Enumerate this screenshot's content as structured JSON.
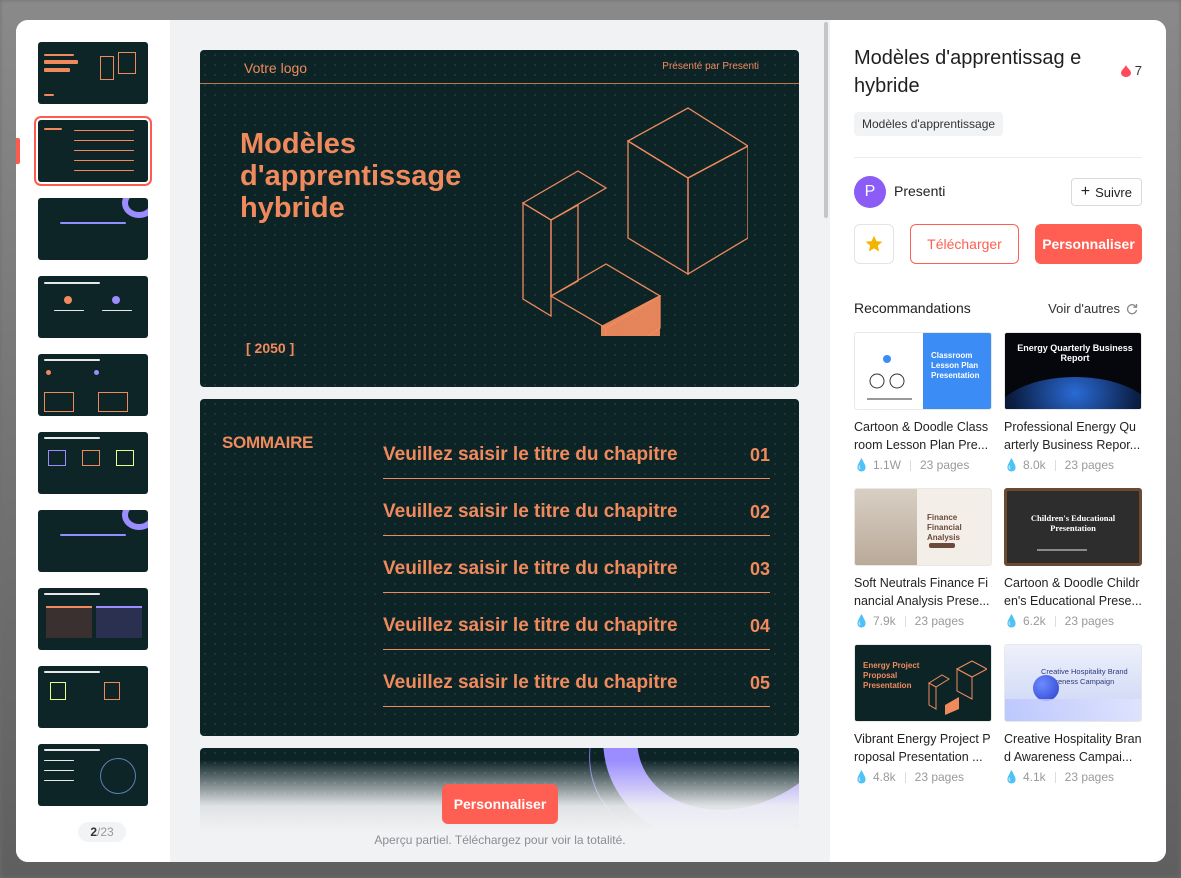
{
  "preview": {
    "slide1": {
      "logo": "Votre logo",
      "presented_by": "Présenté par Presenti",
      "title": "Modèles d'apprentissage hybride",
      "year": "[ 2050 ]"
    },
    "slide2": {
      "heading": "SOMMAIRE",
      "rows": [
        {
          "title": "Veuillez saisir le titre du chapitre",
          "num": "01"
        },
        {
          "title": "Veuillez saisir le titre du chapitre",
          "num": "02"
        },
        {
          "title": "Veuillez saisir le titre du chapitre",
          "num": "03"
        },
        {
          "title": "Veuillez saisir le titre du chapitre",
          "num": "04"
        },
        {
          "title": "Veuillez saisir le titre du chapitre",
          "num": "05"
        }
      ]
    },
    "cta_label": "Personnaliser",
    "partial_note": "Aperçu partiel. Téléchargez pour voir la totalité."
  },
  "thumbnails": {
    "current": "2",
    "total": "/23"
  },
  "info": {
    "title": "Modèles d'apprentissag e hybride",
    "likes": "7",
    "tag": "Modèles d'apprentissage",
    "author_initial": "P",
    "author": "Presenti",
    "follow_label": "Suivre",
    "download_label": "Télécharger",
    "customize_label": "Personnaliser",
    "recommendations_label": "Recommandations",
    "see_more_label": "Voir d'autres"
  },
  "recommendations": [
    {
      "name": "Cartoon & Doodle Classroom Lesson Plan Pre...",
      "views": "1.1W",
      "pages": "23 pages",
      "thumb_text": "Classroom Lesson Plan Presentation"
    },
    {
      "name": "Professional Energy Quarterly Business Repor...",
      "views": "8.0k",
      "pages": "23 pages",
      "thumb_text": "Energy Quarterly Business Report"
    },
    {
      "name": "Soft Neutrals Finance Financial Analysis Prese...",
      "views": "7.9k",
      "pages": "23 pages",
      "thumb_text": "Finance Financial Analysis"
    },
    {
      "name": "Cartoon & Doodle Children's Educational Prese...",
      "views": "6.2k",
      "pages": "23 pages",
      "thumb_text": "Children's Educational Presentation"
    },
    {
      "name": "Vibrant Energy Project Proposal Presentation ...",
      "views": "4.8k",
      "pages": "23 pages",
      "thumb_text": "Energy Project Proposal Presentation"
    },
    {
      "name": "Creative Hospitality Brand Awareness Campai...",
      "views": "4.1k",
      "pages": "23 pages",
      "thumb_text": "Creative Hospitality Brand Awareness Campaign"
    }
  ],
  "colors": {
    "accent": "#ff5f52",
    "slide_bg": "#0d2427",
    "slide_orange": "#f08a5d",
    "avatar": "#8b5cf6"
  }
}
